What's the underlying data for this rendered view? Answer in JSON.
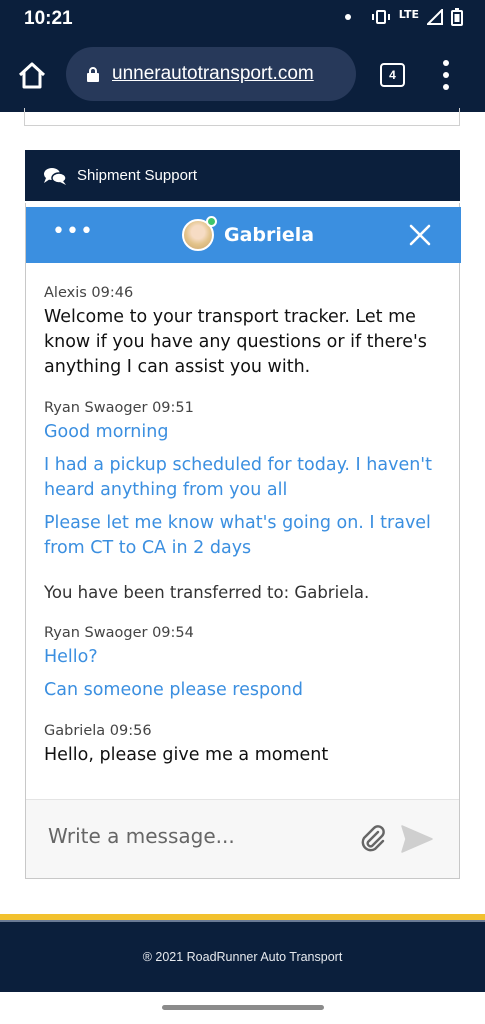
{
  "status_bar": {
    "time": "10:21",
    "network": "LTE"
  },
  "browser": {
    "url": "unnerautotransport.com",
    "tab_count": "4"
  },
  "support": {
    "title": "Shipment Support"
  },
  "chat": {
    "agent_name": "Gabriela",
    "agent_status": "online",
    "groups": [
      {
        "meta": "Alexis 09:46",
        "messages": [
          "Welcome to your transport tracker. Let me know if you have any questions or if there's anything I can assist you with."
        ]
      },
      {
        "meta": "Ryan Swaoger 09:51",
        "messages": [
          "Good morning",
          "I had a pickup scheduled for today. I haven't heard anything from you all",
          "Please let me know what's going on. I travel from CT to CA in 2 days"
        ]
      },
      {
        "system": "You have been transferred to: Gabriela."
      },
      {
        "meta": "Ryan Swaoger 09:54",
        "messages": [
          "Hello?",
          "Can someone please respond"
        ]
      },
      {
        "meta": "Gabriela 09:56",
        "messages": [
          "Hello, please give me a moment"
        ]
      }
    ],
    "compose_placeholder": "Write a message..."
  },
  "footer": {
    "text": "® 2021 RoadRunner Auto Transport"
  },
  "colors": {
    "navy": "#0b1f3c",
    "chat_blue": "#3b8fe0",
    "accent_yellow": "#f2c12e",
    "online_green": "#3ec46d"
  }
}
